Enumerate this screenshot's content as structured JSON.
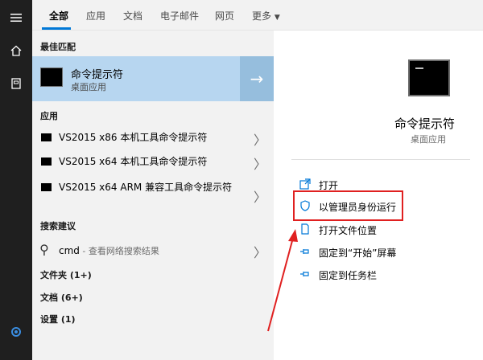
{
  "rail": {
    "icons": [
      "hamburger-icon",
      "home-icon",
      "notebook-icon",
      "cortana-icon"
    ]
  },
  "tabs": [
    {
      "label": "全部",
      "active": true
    },
    {
      "label": "应用",
      "active": false
    },
    {
      "label": "文档",
      "active": false
    },
    {
      "label": "电子邮件",
      "active": false
    },
    {
      "label": "网页",
      "active": false
    },
    {
      "label": "更多",
      "active": false
    }
  ],
  "results": {
    "best_match_header": "最佳匹配",
    "best_match": {
      "title": "命令提示符",
      "subtitle": "桌面应用"
    },
    "apps_header": "应用",
    "apps": [
      "VS2015 x86 本机工具命令提示符",
      "VS2015 x64 本机工具命令提示符",
      "VS2015 x64 ARM 兼容工具命令提示符"
    ],
    "web_header": "搜索建议",
    "web_query": "cmd",
    "web_suffix": " - 查看网络搜索结果",
    "categories": [
      "文件夹 (1+)",
      "文档 (6+)",
      "设置 (1)"
    ]
  },
  "detail": {
    "title": "命令提示符",
    "subtitle": "桌面应用",
    "actions": [
      {
        "label": "打开",
        "icon": "open-icon"
      },
      {
        "label": "以管理员身份运行",
        "icon": "shield-icon"
      },
      {
        "label": "打开文件位置",
        "icon": "file-location-icon"
      },
      {
        "label": "固定到“开始”屏幕",
        "icon": "pin-icon"
      },
      {
        "label": "固定到任务栏",
        "icon": "pin-icon"
      }
    ]
  },
  "colors": {
    "accent": "#0078d7",
    "selected_bg": "#b7d6f0",
    "annotation_red": "#e02020"
  }
}
